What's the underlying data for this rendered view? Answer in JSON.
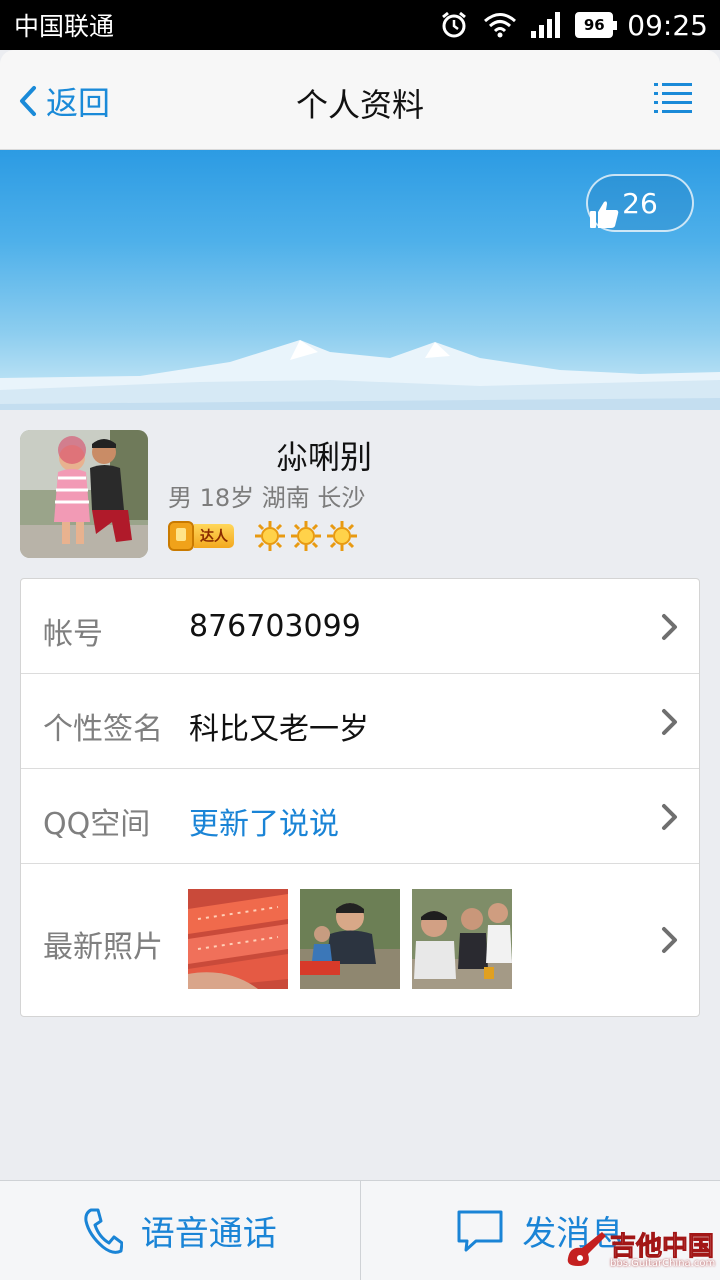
{
  "status_bar": {
    "carrier": "中国联通",
    "battery": "96",
    "time": "09:25",
    "icons": [
      "alarm-icon",
      "wifi-icon",
      "signal-icon",
      "battery-icon"
    ]
  },
  "nav": {
    "back_label": "返回",
    "title": "个人资料",
    "menu_icon": "list-menu-icon"
  },
  "cover": {
    "likes": "26",
    "like_icon": "thumbs-up-icon"
  },
  "profile": {
    "nickname": "尛唎别",
    "meta": "男 18岁 湖南 长沙",
    "badge_label": "达人",
    "sun_level_count": 3
  },
  "info_rows": [
    {
      "label": "帐号",
      "value": "876703099"
    },
    {
      "label": "个性签名",
      "value": "科比又老一岁"
    },
    {
      "label": "QQ空间",
      "value": "更新了说说"
    },
    {
      "label": "最新照片",
      "value": ""
    }
  ],
  "bottom_bar": {
    "call_label": "语音通话",
    "message_label": "发消息"
  },
  "watermark": {
    "title": "吉他中国",
    "subtitle": "bbs.GuitarChina.com"
  },
  "colors": {
    "accent": "#1a84d6",
    "background": "#ebedf1",
    "status_bar": "#000000"
  }
}
